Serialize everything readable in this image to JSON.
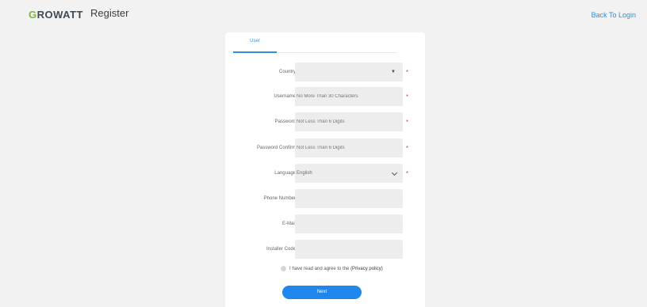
{
  "header": {
    "logo_first": "G",
    "logo_rest": "ROWATT",
    "title": "Register",
    "back_link": "Back To Login"
  },
  "tabs": [
    {
      "label": "User",
      "active": true
    }
  ],
  "form": {
    "country": {
      "label": "Country",
      "value": "",
      "required": true
    },
    "username": {
      "label": "Username",
      "placeholder": "No More Than 30 Characters",
      "required": true
    },
    "password": {
      "label": "Password",
      "placeholder": "Not Less Than 6 Digits",
      "required": true
    },
    "password_confirm": {
      "label": "Password Confirm",
      "placeholder": "Not Less Than 6 Digits",
      "required": true
    },
    "language": {
      "label": "Language",
      "value": "English",
      "required": true
    },
    "phone": {
      "label": "Phone Number",
      "placeholder": ""
    },
    "email": {
      "label": "E-Mail",
      "placeholder": ""
    },
    "installer": {
      "label": "Installer Code",
      "placeholder": ""
    },
    "required_mark": "*",
    "agree_text": "I have read and agree to the",
    "policy_link": "(Privacy policy)",
    "next_label": "Next"
  },
  "icons": {
    "select_caret": "▼"
  },
  "colors": {
    "accent": "#1f86ec",
    "link": "#2f8fdc",
    "logo_green": "#7cb342",
    "required": "#e0454d"
  }
}
